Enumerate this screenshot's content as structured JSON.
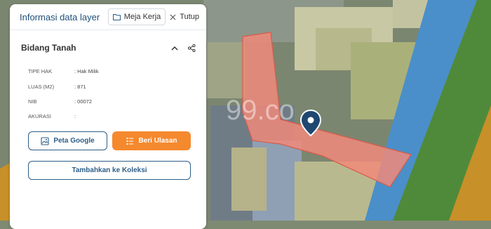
{
  "panel": {
    "title": "Informasi data layer",
    "meja_kerja_label": "Meja Kerja",
    "tutup_label": "Tutup"
  },
  "section": {
    "title": "Bidang Tanah"
  },
  "attributes": [
    {
      "key": "TIPE HAK",
      "value": ": Hak Milik"
    },
    {
      "key": "LUAS (M2)",
      "value": ": 871"
    },
    {
      "key": "NIB",
      "value": ": 00072"
    },
    {
      "key": "AKURASI",
      "value": ":"
    }
  ],
  "actions": {
    "peta_google_label": "Peta Google",
    "beri_ulasan_label": "Beri Ulasan",
    "tambahkan_label": "Tambahkan ke Koleksi"
  },
  "map": {
    "watermark": "99.co"
  },
  "colors": {
    "accent_blue": "#2c5d87",
    "accent_orange": "#f5892e",
    "parcel_fill": "#f08a7a",
    "river": "#4a8fc9"
  }
}
